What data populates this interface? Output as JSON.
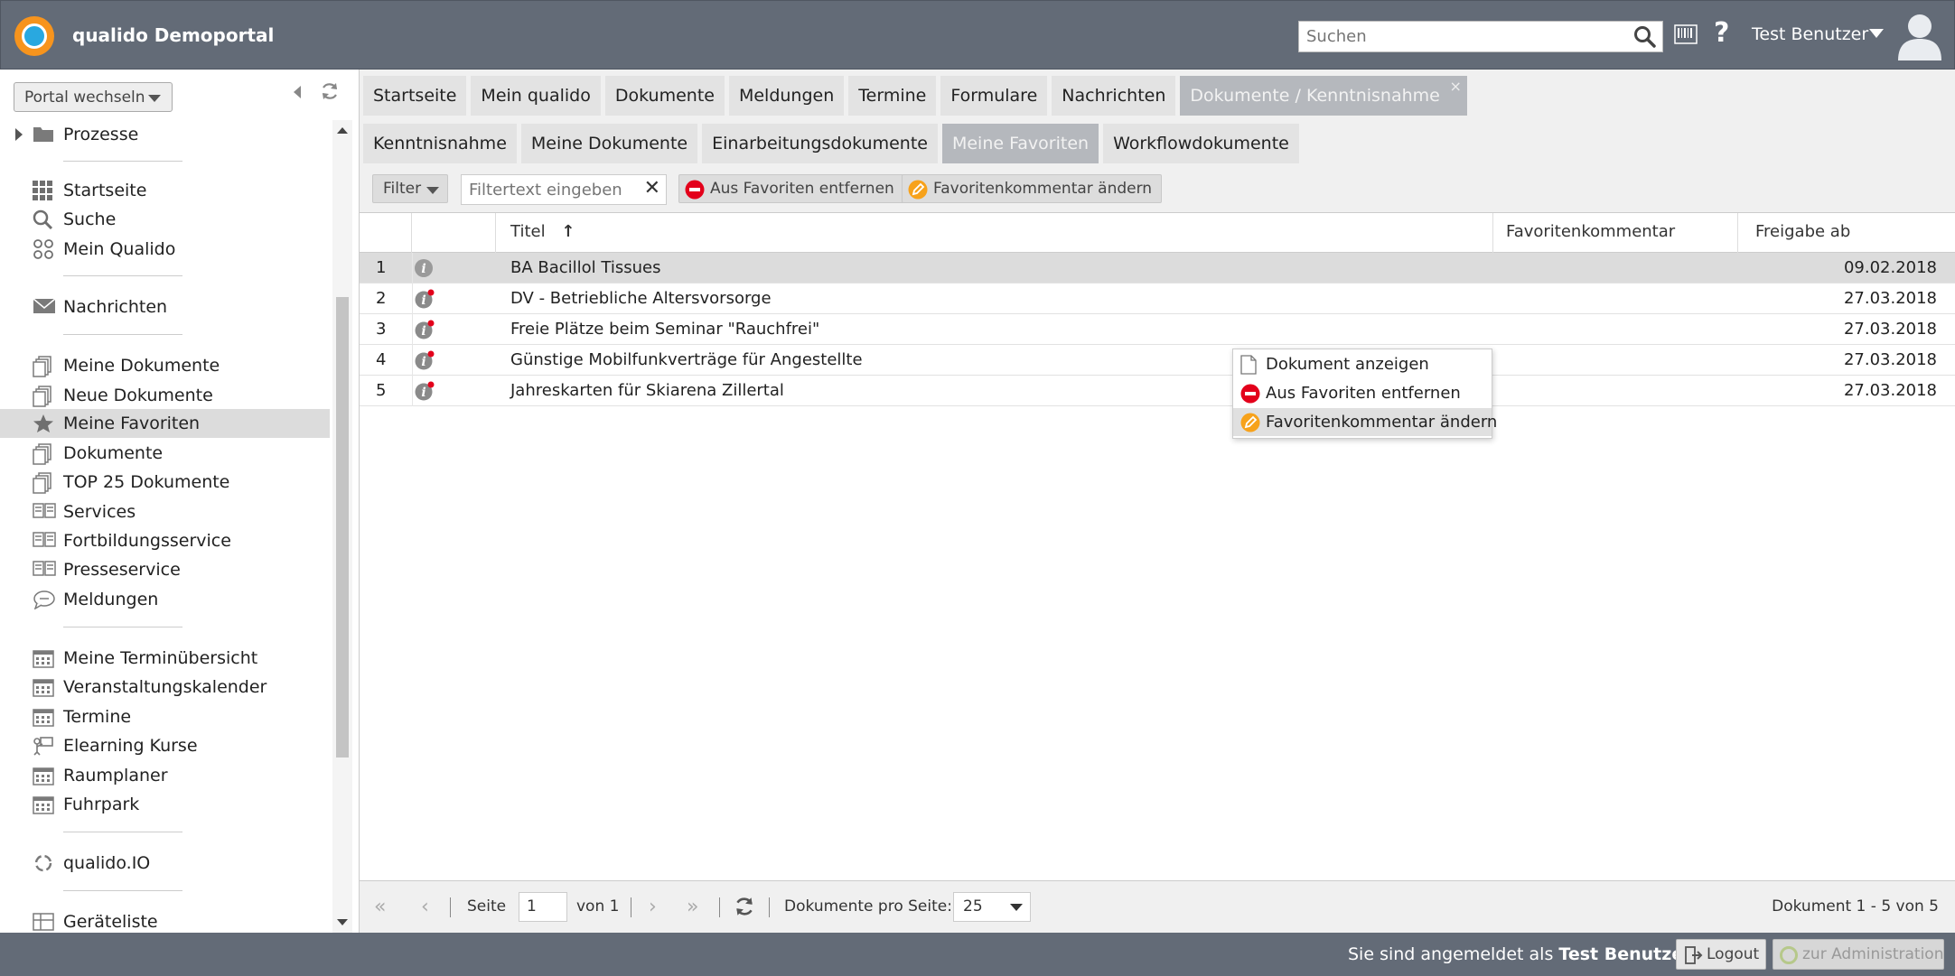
{
  "header": {
    "app_title": "qualido Demoportal",
    "search_placeholder": "Suchen",
    "help_label": "?",
    "user_name": "Test Benutzer"
  },
  "sidebar": {
    "portal_switch_label": "Portal wechseln",
    "tree_item": "Prozesse",
    "items": [
      {
        "label": "Startseite",
        "icon": "grid-icon"
      },
      {
        "label": "Suche",
        "icon": "search-icon"
      },
      {
        "label": "Mein Qualido",
        "icon": "circles-icon"
      },
      {
        "label": "Nachrichten",
        "icon": "envelope-icon"
      },
      {
        "label": "Meine Dokumente",
        "icon": "documents-icon"
      },
      {
        "label": "Neue Dokumente",
        "icon": "documents-icon"
      },
      {
        "label": "Meine Favoriten",
        "icon": "star-icon"
      },
      {
        "label": "Dokumente",
        "icon": "documents-icon"
      },
      {
        "label": "TOP 25 Dokumente",
        "icon": "documents-icon"
      },
      {
        "label": "Services",
        "icon": "book-icon"
      },
      {
        "label": "Fortbildungsservice",
        "icon": "book-icon"
      },
      {
        "label": "Presseservice",
        "icon": "book-icon"
      },
      {
        "label": "Meldungen",
        "icon": "speech-bubble-icon"
      },
      {
        "label": "Meine Terminübersicht",
        "icon": "calendar-icon"
      },
      {
        "label": "Veranstaltungskalender",
        "icon": "calendar-icon"
      },
      {
        "label": "Termine",
        "icon": "calendar-icon"
      },
      {
        "label": "Elearning Kurse",
        "icon": "elearning-icon"
      },
      {
        "label": "Raumplaner",
        "icon": "calendar-icon"
      },
      {
        "label": "Fuhrpark",
        "icon": "calendar-icon"
      },
      {
        "label": "qualido.IO",
        "icon": "qualido-io-icon"
      },
      {
        "label": "Geräteliste",
        "icon": "device-list-icon"
      }
    ]
  },
  "main": {
    "tabs": [
      {
        "label": "Startseite"
      },
      {
        "label": "Mein qualido"
      },
      {
        "label": "Dokumente"
      },
      {
        "label": "Meldungen"
      },
      {
        "label": "Termine"
      },
      {
        "label": "Formulare"
      },
      {
        "label": "Nachrichten"
      },
      {
        "label": "Dokumente / Kenntnisnahme",
        "close": "×"
      }
    ],
    "subtabs": [
      {
        "label": "Kenntnisnahme"
      },
      {
        "label": "Meine Dokumente"
      },
      {
        "label": "Einarbeitungsdokumente"
      },
      {
        "label": "Meine Favoriten"
      },
      {
        "label": "Workflowdokumente"
      }
    ],
    "toolbar": {
      "filter_label": "Filter",
      "filter_placeholder": "Filtertext eingeben",
      "clear_symbol": "✕",
      "remove_favorite_label": "Aus Favoriten entfernen",
      "edit_comment_label": "Favoritenkommentar ändern"
    },
    "grid": {
      "columns": {
        "title": "Titel",
        "sort_arrow": "↑",
        "comment": "Favoritenkommentar",
        "release": "Freigabe ab"
      },
      "rows": [
        {
          "num": "1",
          "title": "BA Bacillol Tissues",
          "date": "09.02.2018"
        },
        {
          "num": "2",
          "title": "DV - Betriebliche Altersvorsorge",
          "date": "27.03.2018"
        },
        {
          "num": "3",
          "title": "Freie Plätze beim Seminar \"Rauchfrei\"",
          "date": "27.03.2018"
        },
        {
          "num": "4",
          "title": "Günstige Mobilfunkverträge für Angestellte",
          "date": "27.03.2018"
        },
        {
          "num": "5",
          "title": "Jahreskarten für Skiarena Zillertal",
          "date": "27.03.2018"
        }
      ]
    },
    "context_menu": {
      "items": [
        {
          "label": "Dokument anzeigen"
        },
        {
          "label": "Aus Favoriten entfernen"
        },
        {
          "label": "Favoritenkommentar ändern"
        }
      ]
    },
    "pager": {
      "first": "«",
      "prev": "‹",
      "next": "›",
      "last": "»",
      "page_label": "Seite",
      "page_value": "1",
      "of_label": "von 1",
      "per_page_label": "Dokumente pro Seite:",
      "per_page_value": "25",
      "summary": "Dokument 1 - 5 von 5"
    }
  },
  "footer": {
    "logged_in_prefix": "Sie sind angemeldet als",
    "logged_in_user": "Test Benutzer",
    "logout_label": "Logout",
    "admin_label": "zur Administration"
  },
  "colors": {
    "header_bg": "#636b77",
    "active_tab": "#b5b8bd",
    "selected_row": "#dcdcdc",
    "remove_red": "#e3001b",
    "edit_orange": "#f7a21b"
  }
}
